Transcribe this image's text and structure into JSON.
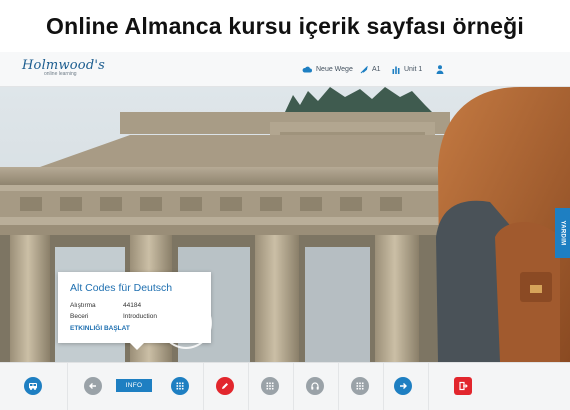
{
  "page_title": "Online Almanca kursu içerik sayfası örneği",
  "header": {
    "logo_text": "Holmwood's",
    "logo_subtext": "online learning",
    "nav": [
      {
        "label": "Neue Wege",
        "icon": "cloud-icon"
      },
      {
        "label": "A1",
        "icon": "rocket-icon"
      },
      {
        "label": "Unit 1",
        "icon": "stats-icon"
      }
    ],
    "user_icon": "user-icon"
  },
  "help_tab": {
    "label": "YARDIM"
  },
  "card": {
    "title": "Alt Codes für Deutsch",
    "rows": [
      {
        "key": "Alıştırma",
        "value": "44184"
      },
      {
        "key": "Beceri",
        "value": "Introduction"
      }
    ],
    "start_link": "ETKINLIĞI BAŞLAT"
  },
  "toolbar": {
    "info_label": "INFO",
    "buttons": [
      {
        "icon": "bus-icon",
        "color": "#1e7fc2"
      },
      {
        "icon": "back-arrow-icon",
        "color": "#9aa2a8"
      },
      {
        "icon": "grid-icon",
        "color": "#1e7fc2"
      },
      {
        "icon": "pencil-icon",
        "color": "#e2262d"
      },
      {
        "icon": "grid-icon",
        "color": "#9aa2a8"
      },
      {
        "icon": "headphones-icon",
        "color": "#9aa2a8"
      },
      {
        "icon": "grid-icon",
        "color": "#9aa2a8"
      },
      {
        "icon": "forward-arrow-icon",
        "color": "#1e7fc2"
      },
      {
        "icon": "exit-icon",
        "color": "#e2262d"
      }
    ]
  },
  "colors": {
    "accent": "#1e7fc2",
    "danger": "#e2262d",
    "neutral": "#9aa2a8"
  }
}
